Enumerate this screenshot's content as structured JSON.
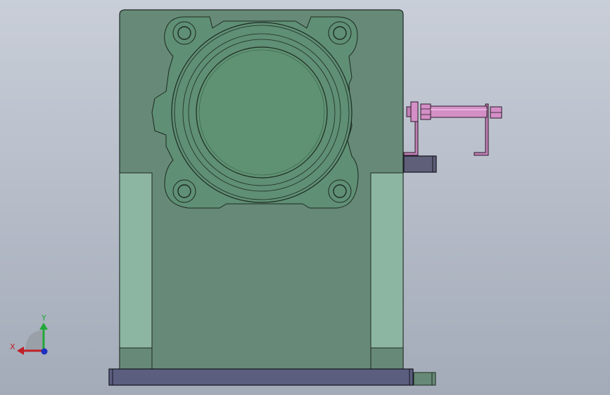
{
  "viewport": {
    "background_top": "#c9ced8",
    "background_bottom": "#a3abb8"
  },
  "model": {
    "housing_color": "#668a77",
    "housing_light_color": "#8db6a2",
    "flange_color": "#5f8f74",
    "base_plate_color": "#5b5e7f",
    "bracket_color": "#5f5f7a",
    "cylinder_color": "#d48fc6",
    "outline_color": "#1e2a22"
  },
  "triad": {
    "x_label": "X",
    "y_label": "Y",
    "x_color": "#c0202a",
    "y_color": "#22a83a",
    "z_color": "#2030c0"
  }
}
